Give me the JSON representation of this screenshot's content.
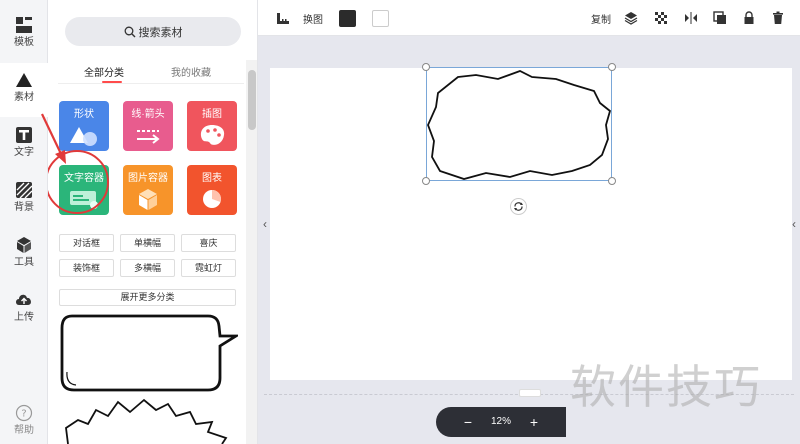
{
  "rail": {
    "items": [
      {
        "label": "模板",
        "icon": "template-icon"
      },
      {
        "label": "素材",
        "icon": "triangle-material-icon"
      },
      {
        "label": "文字",
        "icon": "text-T-icon"
      },
      {
        "label": "背景",
        "icon": "hatched-background-icon"
      },
      {
        "label": "工具",
        "icon": "cube-tool-icon"
      },
      {
        "label": "上传",
        "icon": "cloud-upload-icon"
      },
      {
        "label": "帮助",
        "icon": "help-circle-icon"
      }
    ],
    "active": "素材"
  },
  "panel": {
    "search_label": "搜索素材",
    "tabs": [
      "全部分类",
      "我的收藏"
    ],
    "active_tab": "全部分类",
    "tiles": [
      {
        "label": "形状",
        "color": "#4a86e8"
      },
      {
        "label": "线·箭头",
        "color": "#e85c8e"
      },
      {
        "label": "插图",
        "color": "#f0555d"
      },
      {
        "label": "文字容器",
        "color": "#2bb57a"
      },
      {
        "label": "图片容器",
        "color": "#f7942a"
      },
      {
        "label": "图表",
        "color": "#f2542d"
      }
    ],
    "tags": [
      "对话框",
      "单横幅",
      "喜庆",
      "装饰框",
      "多横幅",
      "霓虹灯"
    ],
    "expand_label": "展开更多分类"
  },
  "toolbar": {
    "swap_label": "换图",
    "fill_color": "#2b2b2b",
    "stroke_color": "#ffffff",
    "copy_label": "复制",
    "icons": [
      "ruler-icon",
      "layers-icon",
      "transparency-icon",
      "flip-icon",
      "duplicate-icon",
      "lock-icon",
      "delete-icon"
    ]
  },
  "zoom": {
    "value": "12%",
    "minus": "−",
    "plus": "+"
  },
  "watermark": "软件技巧"
}
